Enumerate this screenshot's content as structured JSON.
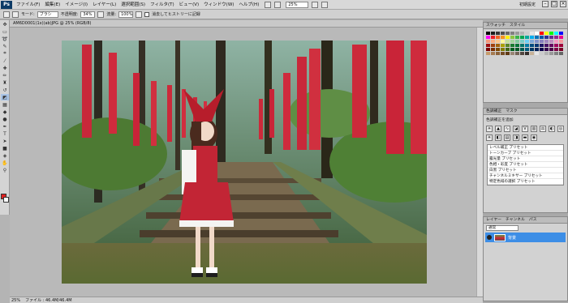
{
  "menubar": {
    "logo": "Ps",
    "items": [
      "ファイル(F)",
      "編集(E)",
      "イメージ(I)",
      "レイヤー(L)",
      "選択範囲(S)",
      "フィルタ(T)",
      "ビュー(V)",
      "ウィンドウ(W)",
      "ヘルプ(H)"
    ],
    "zoom": "25%",
    "workspace": "初期設定",
    "min": "–",
    "max": "□",
    "close": "×"
  },
  "options": {
    "mode_label": "モード:",
    "mode_value": "ブラシ",
    "opacity_label": "不透明度:",
    "opacity_value": "34%",
    "flow_label": "流量:",
    "flow_value": "100%",
    "erase_history": "消去してヒストリーに記録"
  },
  "document": {
    "tab_title": "AM6D0001(1x)(ab)JPG @ 25% (RGB/8)",
    "status_zoom": "25%",
    "status_doc": "ファイル : 46.4M/46.4M"
  },
  "panels": {
    "swatches_tabs": [
      "スウォッチ",
      "スタイル"
    ],
    "swatch_colors": [
      "#000000",
      "#1a1a1a",
      "#333333",
      "#4d4d4d",
      "#666666",
      "#808080",
      "#999999",
      "#b3b3b3",
      "#cccccc",
      "#e6e6e6",
      "#ffffff",
      "#ff0000",
      "#ffff00",
      "#00ff00",
      "#00ffff",
      "#0000ff",
      "#ff00ff",
      "#ed1c24",
      "#f26522",
      "#f7941d",
      "#fff200",
      "#8dc63f",
      "#39b54a",
      "#00a651",
      "#00a99d",
      "#00aeef",
      "#0072bc",
      "#0054a6",
      "#2e3192",
      "#662d91",
      "#92278f",
      "#ec008c",
      "#f7977a",
      "#f9ad81",
      "#fdc68a",
      "#fff79a",
      "#c4df9b",
      "#a3d39c",
      "#82ca9d",
      "#7bcdc8",
      "#6ecff6",
      "#7ea7d8",
      "#8493ca",
      "#8882be",
      "#a187be",
      "#bc8dbf",
      "#f49ac2",
      "#f6989d",
      "#9e0b0f",
      "#a0410d",
      "#a36209",
      "#aba000",
      "#598527",
      "#1a7b30",
      "#007236",
      "#00746b",
      "#0076a3",
      "#004b80",
      "#003471",
      "#1b1464",
      "#440e62",
      "#630460",
      "#9e005d",
      "#9e0039",
      "#790000",
      "#7b2e00",
      "#7d4900",
      "#827b00",
      "#406618",
      "#005e20",
      "#005826",
      "#005952",
      "#005b7f",
      "#003663",
      "#002157",
      "#0d004c",
      "#32004b",
      "#4b0049",
      "#7b0046",
      "#7a0026",
      "#c69c6d",
      "#a67c52",
      "#8c6239",
      "#754c24",
      "#603913",
      "#998675",
      "#736357",
      "#534741",
      "#362f2d",
      "#c7b299",
      "#e6e6e6",
      "#cccccc",
      "#b3b3b3",
      "#999999",
      "#808080",
      "#666666"
    ],
    "adjustments_tabs": [
      "色調補正",
      "マスク"
    ],
    "adjustments_title": "色調補正を追加",
    "presets": [
      "レベル補正 プリセット",
      "トーンカーブ プリセット",
      "露光量 プリセット",
      "色相・彩度 プリセット",
      "白黒 プリセット",
      "チャンネルミキサー プリセット",
      "特定色域の選択 プリセット"
    ],
    "layers_tabs": [
      "レイヤー",
      "チャンネル",
      "パス"
    ],
    "blend_mode": "通常",
    "layer_name": "背景"
  },
  "colors": {
    "foreground": "#e02020",
    "background": "#ffffff",
    "selection": "#3d8ee6"
  }
}
